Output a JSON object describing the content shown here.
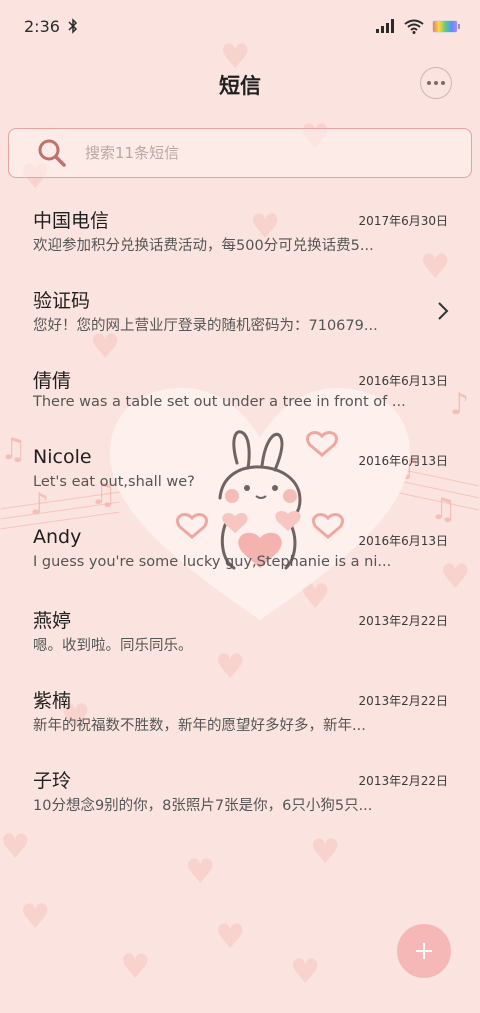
{
  "status_bar": {
    "time": "2:36"
  },
  "header": {
    "title": "短信"
  },
  "search": {
    "placeholder": "搜索11条短信"
  },
  "messages": [
    {
      "name": "中国电信",
      "date": "2017年6月30日",
      "preview": "欢迎参加积分兑换话费活动，每500分可兑换话费5...",
      "chevron": false
    },
    {
      "name": "验证码",
      "date": "",
      "preview": "您好！您的网上营业厅登录的随机密码为：710679...",
      "chevron": true
    },
    {
      "name": "倩倩",
      "date": "2016年6月13日",
      "preview": "There was a table set out under a tree in front of ...",
      "chevron": false
    },
    {
      "name": "Nicole",
      "date": "2016年6月13日",
      "preview": "Let's eat out,shall we?",
      "chevron": false
    },
    {
      "name": "Andy",
      "date": "2016年6月13日",
      "preview": "I guess you're some lucky guy,Stephanie is a ni...",
      "chevron": false
    },
    {
      "name": "燕婷",
      "date": "2013年2月22日",
      "preview": "嗯。收到啦。同乐同乐。",
      "chevron": false
    },
    {
      "name": "紫楠",
      "date": "2013年2月22日",
      "preview": "新年的祝福数不胜数，新年的愿望好多好多，新年...",
      "chevron": false
    },
    {
      "name": "子玲",
      "date": "2013年2月22日",
      "preview": "10分想念9别的你，8张照片7张是你，6只小狗5只...",
      "chevron": false
    }
  ],
  "colors": {
    "background": "#fbe4df",
    "accent": "#e6a3a0",
    "fab": "#f5b8b6"
  }
}
